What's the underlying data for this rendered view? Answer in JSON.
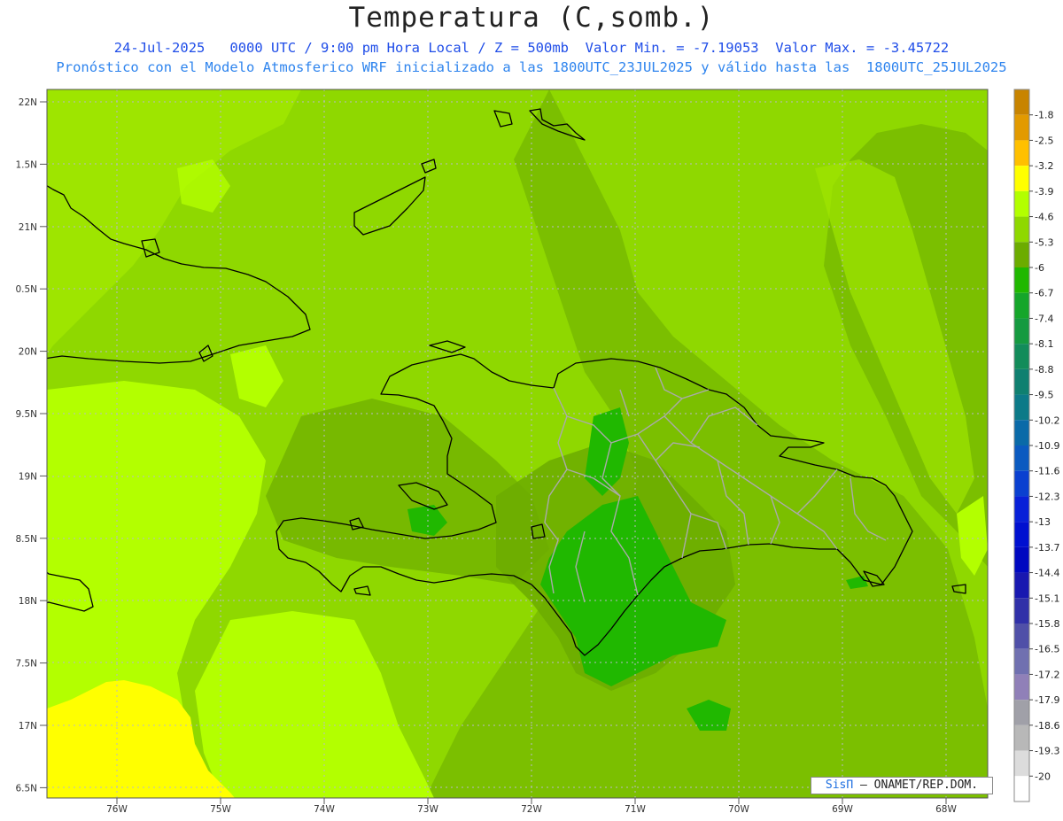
{
  "header": {
    "title": "Temperatura (C,somb.)",
    "subtitle_line1": "24-Jul-2025   0000 UTC / 9:00 pm Hora Local / Z = 500mb  Valor Min. = -7.19053  Valor Max. = -3.45722",
    "subtitle_line2": "Pronóstico con el Modelo Atmosferico WRF inicializado a las 1800UTC_23JUL2025 y válido hasta las  1800UTC_25JUL2025"
  },
  "map": {
    "lat_labels": [
      "22N",
      "1.5N",
      "21N",
      "0.5N",
      "20N",
      "9.5N",
      "19N",
      "8.5N",
      "18N",
      "7.5N",
      "17N",
      "6.5N"
    ],
    "lon_labels": [
      "76W",
      "75W",
      "74W",
      "73W",
      "72W",
      "71W",
      "70W",
      "69W",
      "68W"
    ],
    "grid": true
  },
  "legend": {
    "labels": [
      "-1.8",
      "-2.5",
      "-3.2",
      "-3.9",
      "-4.6",
      "-5.3",
      "-6",
      "-6.7",
      "-7.4",
      "-8.1",
      "-8.8",
      "-9.5",
      "-10.2",
      "-10.9",
      "-11.6",
      "-12.3",
      "-13",
      "-13.7",
      "-14.4",
      "-15.1",
      "-15.8",
      "-16.5",
      "-17.2",
      "-17.9",
      "-18.6",
      "-19.3",
      "-20"
    ],
    "colors": [
      "#c88400",
      "#e29a00",
      "#ffc000",
      "#ffff00",
      "#b3ff00",
      "#8fd800",
      "#6cac00",
      "#20b800",
      "#15a62a",
      "#159a40",
      "#128c5a",
      "#0f8070",
      "#0c7a88",
      "#0a6aa8",
      "#0b5ac0",
      "#0a40d0",
      "#0820d8",
      "#0010d0",
      "#0008c0",
      "#1818b0",
      "#3030a8",
      "#5050a8",
      "#7070b0",
      "#9080b8",
      "#a0a0a8",
      "#b8b8b8",
      "#dcdcdc"
    ]
  },
  "credit": {
    "brand": "SisΠ",
    "text": "– ONAMET/REP.DOM."
  },
  "colors": {
    "land_outline": "#000000",
    "province_lines": "#aaaaaa",
    "grid": "#b8b8c8",
    "subtitle": "#1f4de8"
  }
}
